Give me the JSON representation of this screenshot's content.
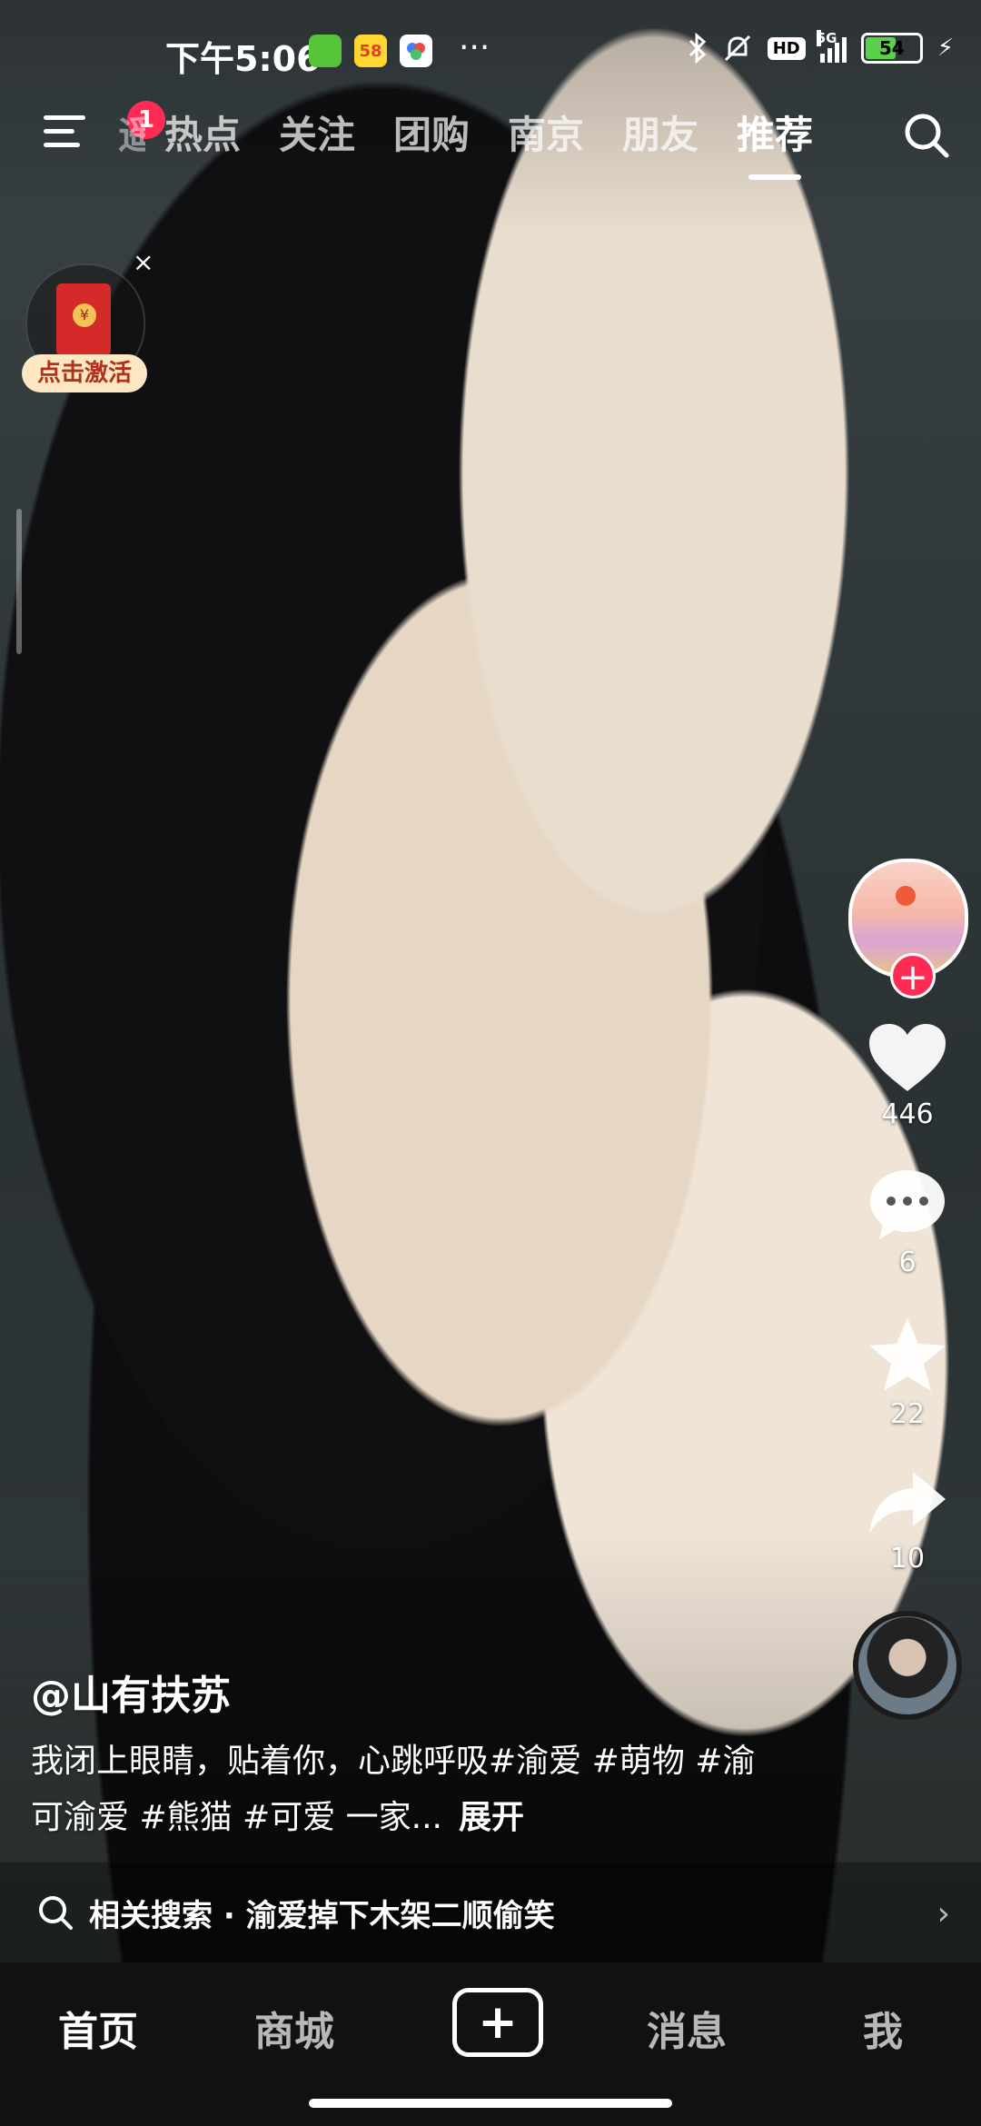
{
  "status_bar": {
    "time": "下午5:06",
    "apps": [
      {
        "icon": "wechat-app-icon",
        "color": "#57c53a",
        "label": ""
      },
      {
        "icon": "58-app-icon",
        "color": "#fdd835",
        "label": "58"
      },
      {
        "icon": "baidu-map-app-icon",
        "color": "#ffffff",
        "label": ""
      }
    ],
    "more": "···",
    "network": "5G",
    "hd": "HD",
    "battery": "54"
  },
  "top_nav": {
    "menu_badge": "1",
    "tabs": [
      {
        "label": "遥",
        "active": false
      },
      {
        "label": "热点",
        "active": false
      },
      {
        "label": "关注",
        "active": false
      },
      {
        "label": "团购",
        "active": false
      },
      {
        "label": "南京",
        "active": false
      },
      {
        "label": "朋友",
        "active": false
      },
      {
        "label": "推荐",
        "active": true
      }
    ]
  },
  "red_packet": {
    "label": "点击激活",
    "close": "×"
  },
  "actions": {
    "like_count": "446",
    "comment_count": "6",
    "favorite_count": "22",
    "share_count": "10"
  },
  "caption": {
    "author": "@山有扶苏",
    "description": "我闭上眼睛，贴着你，心跳呼吸#渝爱 #萌物 #渝可渝爱 #熊猫 #可爱 一家...",
    "expand": "展开"
  },
  "related_search": {
    "text": "相关搜索 · 渝爱掉下木架二顺偷笑"
  },
  "bottom_nav": {
    "home": "首页",
    "mall": "商城",
    "messages": "消息",
    "me": "我"
  },
  "colors": {
    "accent": "#fe2c55",
    "battery_fill": "#5bd04a",
    "red_packet": "#d52a2a"
  }
}
